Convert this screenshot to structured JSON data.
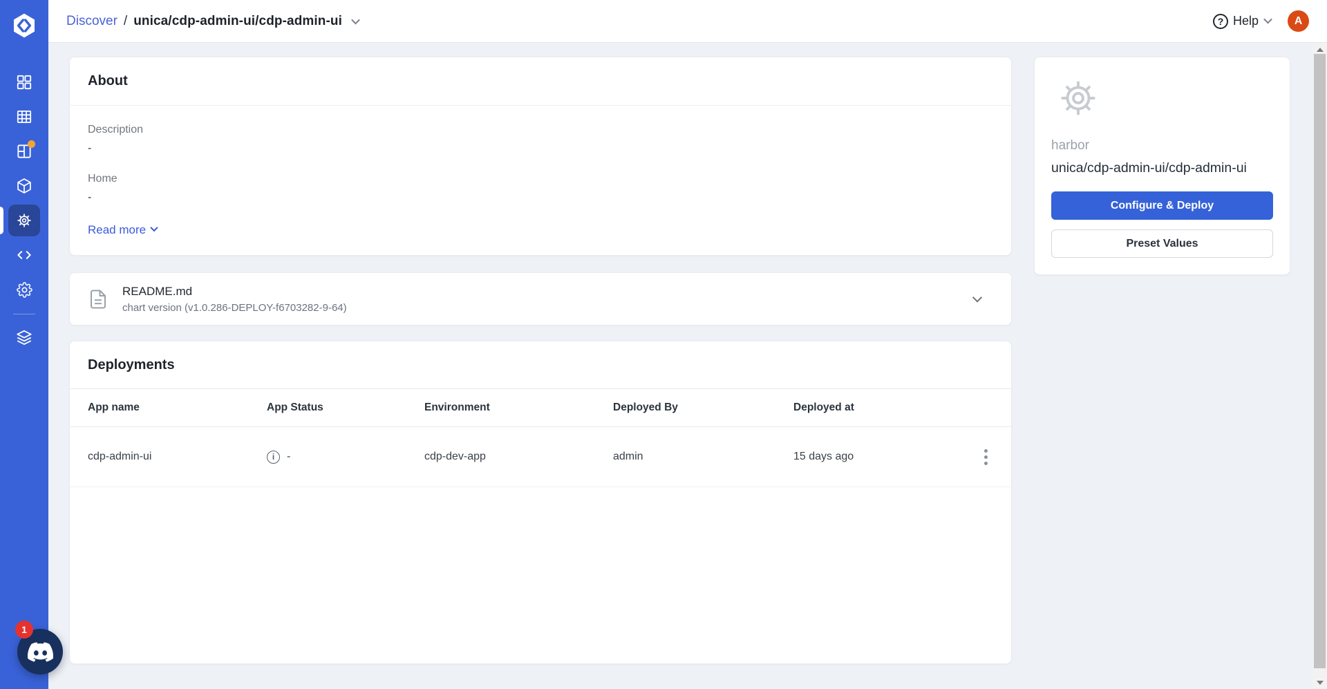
{
  "header": {
    "breadcrumb": {
      "section": "Discover",
      "separator": "/",
      "current": "unica/cdp-admin-ui/cdp-admin-ui"
    },
    "help_label": "Help",
    "help_icon": "question-circle-icon",
    "avatar_initial": "A"
  },
  "sidebar": {
    "logo_icon": "devtron-logo",
    "items": [
      {
        "id": "applications",
        "icon": "grid-icon",
        "active": false
      },
      {
        "id": "jobs",
        "icon": "table-icon",
        "active": false
      },
      {
        "id": "application-groups",
        "icon": "layout-icon",
        "badge": "orange-dot",
        "active": false
      },
      {
        "id": "resource-browser",
        "icon": "cube-icon",
        "active": false
      },
      {
        "id": "chart-store",
        "icon": "helm-wheel-icon",
        "active": true
      },
      {
        "id": "code",
        "icon": "code-icon",
        "active": false
      },
      {
        "id": "global-configurations",
        "icon": "gear-icon",
        "active": false
      },
      {
        "id": "stack-manager",
        "icon": "layers-icon",
        "active": false
      }
    ]
  },
  "about": {
    "title": "About",
    "fields": [
      {
        "label": "Description",
        "value": "-"
      },
      {
        "label": "Home",
        "value": "-"
      }
    ],
    "read_more_label": "Read more"
  },
  "readme": {
    "icon": "file-text-icon",
    "title": "README.md",
    "subtitle": "chart version (v1.0.286-DEPLOY-f6703282-9-64)"
  },
  "deployments": {
    "title": "Deployments",
    "columns": [
      "App name",
      "App Status",
      "Environment",
      "Deployed By",
      "Deployed at"
    ],
    "rows": [
      {
        "app_name": "cdp-admin-ui",
        "app_status": "-",
        "environment": "cdp-dev-app",
        "deployed_by": "admin",
        "deployed_at": "15 days ago"
      }
    ]
  },
  "chart_panel": {
    "icon": "helm-wheel-placeholder-icon",
    "repo": "harbor",
    "name": "unica/cdp-admin-ui/cdp-admin-ui",
    "deploy_label": "Configure & Deploy",
    "preset_label": "Preset Values"
  },
  "chat_widget": {
    "icon": "discord-icon",
    "badge_count": "1"
  },
  "colors": {
    "sidebar": "#3a62d8",
    "sidebar_active": "#2a4698",
    "accent_blue": "#3562d8",
    "link_blue": "#4a63d8",
    "avatar_orange": "#d94a15",
    "badge_red": "#e5322d",
    "chat_navy": "#17305e",
    "page_background": "#eef1f6",
    "notification_dot": "#f2a531"
  }
}
